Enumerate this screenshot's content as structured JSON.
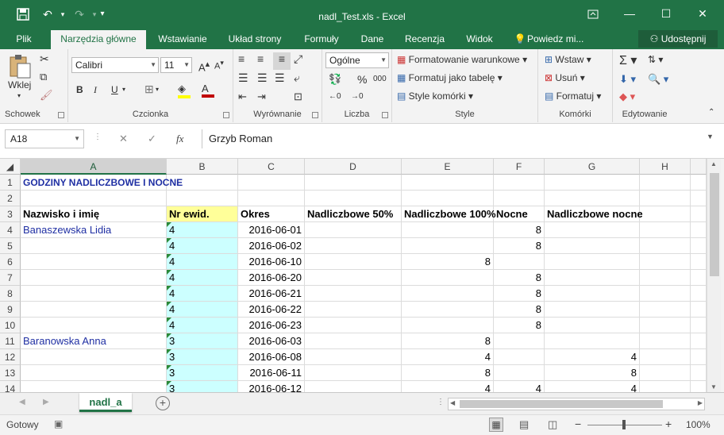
{
  "window": {
    "title": "nadl_Test.xls - Excel"
  },
  "tabs": [
    "Plik",
    "Narzędzia główne",
    "Wstawianie",
    "Układ strony",
    "Formuły",
    "Dane",
    "Recenzja",
    "Widok",
    "Powiedz mi..."
  ],
  "share_label": "Udostępnij",
  "ribbon": {
    "clipboard": {
      "paste": "Wklej",
      "label": "Schowek"
    },
    "font": {
      "name": "Calibri",
      "size": "11",
      "label": "Czcionka",
      "bold": "B",
      "italic": "I",
      "underline": "U"
    },
    "alignment": {
      "label": "Wyrównanie"
    },
    "number": {
      "format": "Ogólne",
      "label": "Liczba",
      "percent": "%",
      "thousands": "000"
    },
    "styles": {
      "conditional": "Formatowanie warunkowe",
      "table": "Formatuj jako tabelę",
      "cell": "Style komórki",
      "label": "Style"
    },
    "cells": {
      "insert": "Wstaw",
      "delete": "Usuń",
      "format": "Formatuj",
      "label": "Komórki"
    },
    "editing": {
      "label": "Edytowanie"
    }
  },
  "formula_bar": {
    "name_box": "A18",
    "cancel": "✕",
    "enter": "✓",
    "fx": "fx",
    "content": "Grzyb Roman"
  },
  "columns": [
    "A",
    "B",
    "C",
    "D",
    "E",
    "F",
    "G",
    "H"
  ],
  "rows": [
    {
      "n": "1",
      "a": "GODZINY NADLICZBOWE I NOCNE",
      "b": "",
      "c": "",
      "d": "",
      "e": "",
      "f": "",
      "g": ""
    },
    {
      "n": "2",
      "a": "",
      "b": "",
      "c": "",
      "d": "",
      "e": "",
      "f": "",
      "g": ""
    },
    {
      "n": "3",
      "a": "Nazwisko i imię",
      "b": "Nr ewid.",
      "c": "Okres",
      "d": "Nadliczbowe 50%",
      "e": "Nadliczbowe 100%",
      "f": "Nocne",
      "g": "Nadliczbowe nocne"
    },
    {
      "n": "4",
      "a": "Banaszewska Lidia",
      "b": "4",
      "c": "2016-06-01",
      "d": "",
      "e": "",
      "f": "8",
      "g": ""
    },
    {
      "n": "5",
      "a": "",
      "b": "4",
      "c": "2016-06-02",
      "d": "",
      "e": "",
      "f": "8",
      "g": ""
    },
    {
      "n": "6",
      "a": "",
      "b": "4",
      "c": "2016-06-10",
      "d": "",
      "e": "8",
      "f": "",
      "g": ""
    },
    {
      "n": "7",
      "a": "",
      "b": "4",
      "c": "2016-06-20",
      "d": "",
      "e": "",
      "f": "8",
      "g": ""
    },
    {
      "n": "8",
      "a": "",
      "b": "4",
      "c": "2016-06-21",
      "d": "",
      "e": "",
      "f": "8",
      "g": ""
    },
    {
      "n": "9",
      "a": "",
      "b": "4",
      "c": "2016-06-22",
      "d": "",
      "e": "",
      "f": "8",
      "g": ""
    },
    {
      "n": "10",
      "a": "",
      "b": "4",
      "c": "2016-06-23",
      "d": "",
      "e": "",
      "f": "8",
      "g": ""
    },
    {
      "n": "11",
      "a": "Baranowska Anna",
      "b": "3",
      "c": "2016-06-03",
      "d": "",
      "e": "8",
      "f": "",
      "g": ""
    },
    {
      "n": "12",
      "a": "",
      "b": "3",
      "c": "2016-06-08",
      "d": "",
      "e": "4",
      "f": "",
      "g": "4"
    },
    {
      "n": "13",
      "a": "",
      "b": "3",
      "c": "2016-06-11",
      "d": "",
      "e": "8",
      "f": "",
      "g": "8"
    },
    {
      "n": "14",
      "a": "",
      "b": "3",
      "c": "2016-06-12",
      "d": "",
      "e": "4",
      "f": "4",
      "g": "4"
    }
  ],
  "sheet_tab": "nadl_a",
  "status": {
    "ready": "Gotowy",
    "zoom": "100%",
    "minus": "−",
    "plus": "+"
  }
}
